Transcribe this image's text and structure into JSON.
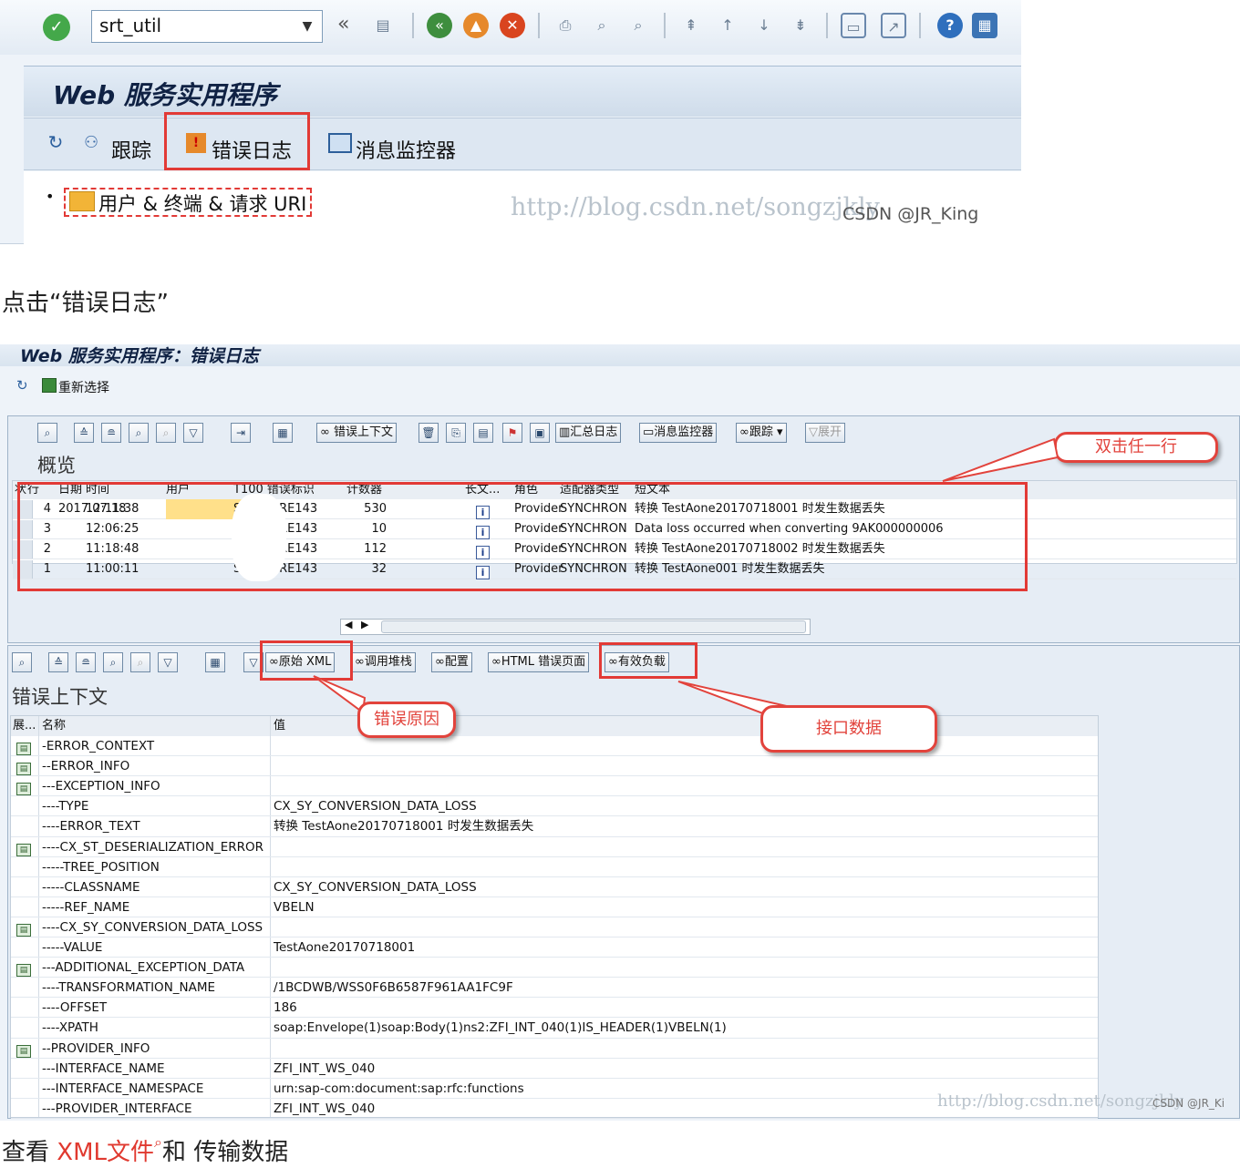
{
  "shot1": {
    "command_value": "srt_util",
    "toolbar_icons": [
      "back-nav-icon",
      "save-icon",
      "back-icon",
      "exit-icon",
      "cancel-icon",
      "print-icon",
      "find-icon",
      "find-next-icon",
      "first-page-icon",
      "prev-page-icon",
      "next-page-icon",
      "last-page-icon",
      "new-session-icon",
      "shortcut-icon",
      "help-icon",
      "customize-layout-icon"
    ],
    "app_title": "Web 服务实用程序",
    "app_toolbar": {
      "trace": "跟踪",
      "error_log": "错误日志",
      "message_monitor": "消息监控器"
    },
    "tree_node": "用户 & 终端 & 请求 URI",
    "watermark_url": "http://blog.csdn.net/songzjkly",
    "watermark_csdn": "CSDN @JR_King"
  },
  "caption1": "点击“错误日志”",
  "shot2": {
    "title": "Web 服务实用程序：错误日志",
    "reselect": "重新选择",
    "toolbar1": {
      "error_context": "错误上下文",
      "summary_log": "汇总日志",
      "message_monitor": "消息监控器",
      "trace": "跟踪",
      "expand": "展开"
    },
    "overview_title": "概览",
    "callout_doubleclick": "双击任一行",
    "overview_table": {
      "headers": [
        "状",
        "行",
        "日期",
        "时间",
        "用户",
        "T100 错误标识",
        "计数器",
        "长文...",
        "角色",
        "适配器类型",
        "短文本"
      ],
      "rows": [
        [
          "4",
          "2017.07.18",
          "12:11:38",
          "",
          "SRT_CORE143",
          "530",
          "Provider",
          "SYNCHRON",
          "转换 TestAone20170718001 时发生数据丢失"
        ],
        [
          "3",
          "",
          "12:06:25",
          "",
          "SRT_CORE143",
          "10",
          "Provider",
          "SYNCHRON",
          "Data loss occurred when converting 9AK000000006"
        ],
        [
          "2",
          "",
          "11:18:48",
          "",
          "SRT_CORE143",
          "112",
          "Provider",
          "SYNCHRON",
          "转换 TestAone20170718002 时发生数据丢失"
        ],
        [
          "1",
          "",
          "11:00:11",
          "",
          "SRT_CORE143",
          "32",
          "Provider",
          "SYNCHRON",
          "转换 TestAone001 时发生数据丢失"
        ]
      ]
    },
    "toolbar2": {
      "raw_xml": "原始 XML",
      "call_stack": "调用堆栈",
      "config": "配置",
      "html_error_page": "HTML 错误页面",
      "payload": "有效负载"
    },
    "callout_error_reason": "错误原因",
    "callout_interface_data": "接口数据",
    "context_title": "错误上下文",
    "context_table": {
      "headers": [
        "展...",
        "名称",
        "值"
      ],
      "rows": [
        {
          "folder": true,
          "name": "-ERROR_CONTEXT",
          "value": ""
        },
        {
          "folder": true,
          "name": "--ERROR_INFO",
          "value": ""
        },
        {
          "folder": true,
          "name": "---EXCEPTION_INFO",
          "value": ""
        },
        {
          "folder": false,
          "name": "----TYPE",
          "value": "CX_SY_CONVERSION_DATA_LOSS"
        },
        {
          "folder": false,
          "name": "----ERROR_TEXT",
          "value": "转换 TestAone20170718001 时发生数据丢失"
        },
        {
          "folder": true,
          "name": "----CX_ST_DESERIALIZATION_ERROR",
          "value": ""
        },
        {
          "folder": false,
          "name": "-----TREE_POSITION",
          "value": ""
        },
        {
          "folder": false,
          "name": "-----CLASSNAME",
          "value": "CX_SY_CONVERSION_DATA_LOSS"
        },
        {
          "folder": false,
          "name": "-----REF_NAME",
          "value": "VBELN"
        },
        {
          "folder": true,
          "name": "----CX_SY_CONVERSION_DATA_LOSS",
          "value": ""
        },
        {
          "folder": false,
          "name": "-----VALUE",
          "value": "TestAone20170718001"
        },
        {
          "folder": true,
          "name": "---ADDITIONAL_EXCEPTION_DATA",
          "value": ""
        },
        {
          "folder": false,
          "name": "----TRANSFORMATION_NAME",
          "value": "/1BCDWB/WSS0F6B6587F961AA1FC9F"
        },
        {
          "folder": false,
          "name": "----OFFSET",
          "value": "186"
        },
        {
          "folder": false,
          "name": "----XPATH",
          "value": "soap:Envelope(1)soap:Body(1)ns2:ZFI_INT_040(1)IS_HEADER(1)VBELN(1)"
        },
        {
          "folder": true,
          "name": "--PROVIDER_INFO",
          "value": ""
        },
        {
          "folder": false,
          "name": "---INTERFACE_NAME",
          "value": "ZFI_INT_WS_040"
        },
        {
          "folder": false,
          "name": "---INTERFACE_NAMESPACE",
          "value": "urn:sap-com:document:sap:rfc:functions"
        },
        {
          "folder": false,
          "name": "---PROVIDER_INTERFACE",
          "value": "ZFI_INT_WS_040"
        }
      ]
    },
    "watermark_url": "http://blog.csdn.net/songzjkly",
    "watermark_csdn": "CSDN @JR_Ki"
  },
  "caption2": {
    "prefix": "查看 ",
    "link": "XML文件",
    "suffix": "和 传输数据"
  },
  "colors": {
    "highlight_red": "#e23a36",
    "sap_blue_bg": "#eef3f9"
  }
}
